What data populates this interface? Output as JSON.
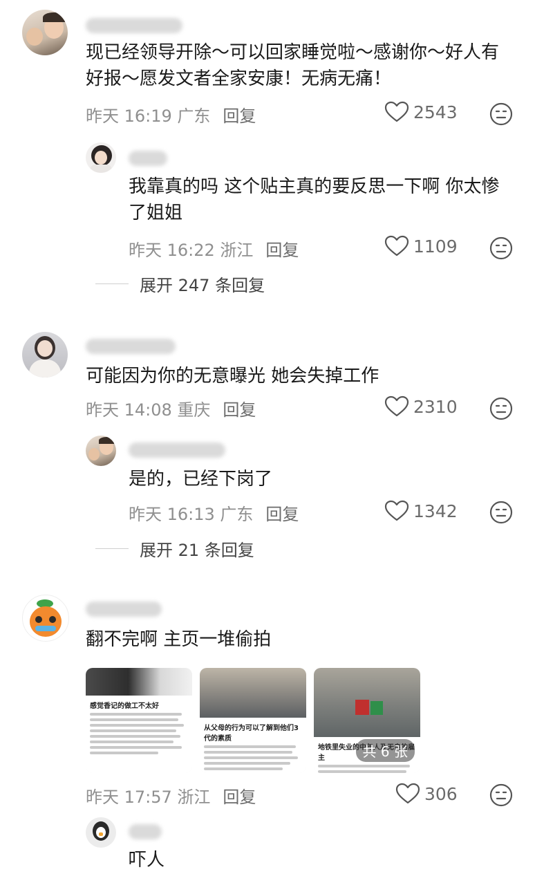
{
  "comments": [
    {
      "text": "现已经领导开除～可以回家睡觉啦～感谢你～好人有好报～愿发文者全家安康！无病无痛！",
      "time": "昨天 16:19 广东",
      "reply": "回复",
      "likes": "2543",
      "replies": [
        {
          "text": "我靠真的吗 这个贴主真的要反思一下啊 你太惨了姐姐",
          "time": "昨天 16:22 浙江",
          "reply": "回复",
          "likes": "1109"
        }
      ],
      "expand": "展开 247 条回复"
    },
    {
      "text": "可能因为你的无意曝光 她会失掉工作",
      "time": "昨天 14:08 重庆",
      "reply": "回复",
      "likes": "2310",
      "replies": [
        {
          "text": "是的，已经下岗了",
          "time": "昨天 16:13 广东",
          "reply": "回复",
          "likes": "1342"
        }
      ],
      "expand": "展开 21 条回复"
    },
    {
      "text": "翻不完啊 主页一堆偷拍",
      "time": "昨天 17:57 浙江",
      "reply": "回复",
      "likes": "306",
      "images": [
        {
          "headline": "感觉香记的做工不太好"
        },
        {
          "headline": "从父母的行为可以了解到他们3代的素质"
        },
        {
          "headline": "地铁里失业的中年人及无良的雇主"
        }
      ],
      "image_count": "共 6 张",
      "replies": [
        {
          "text": "吓人"
        }
      ]
    }
  ],
  "icons": {
    "like": "heart-outline-icon",
    "react": "neutral-face-icon"
  },
  "colors": {
    "text": "#1a1a1a",
    "meta": "#8f8f8f",
    "background": "#ffffff"
  }
}
